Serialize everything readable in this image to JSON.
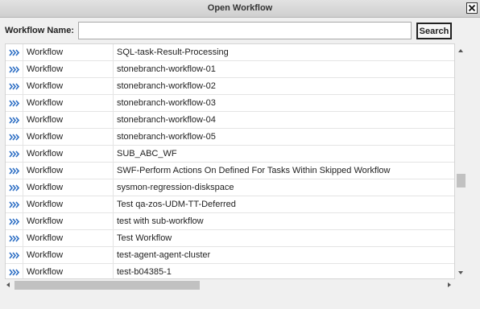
{
  "dialog": {
    "title": "Open Workflow",
    "close_icon": "close-x-icon"
  },
  "search": {
    "label": "Workflow Name:",
    "value": "",
    "placeholder": "",
    "button_label": "Search"
  },
  "table": {
    "row_icon": "triple-chevron-right-icon",
    "row_icon_color": "#2e6fc4",
    "rows": [
      {
        "type": "Workflow",
        "name": "SQL-task-Result-Processing"
      },
      {
        "type": "Workflow",
        "name": "stonebranch-workflow-01"
      },
      {
        "type": "Workflow",
        "name": "stonebranch-workflow-02"
      },
      {
        "type": "Workflow",
        "name": "stonebranch-workflow-03"
      },
      {
        "type": "Workflow",
        "name": "stonebranch-workflow-04"
      },
      {
        "type": "Workflow",
        "name": "stonebranch-workflow-05"
      },
      {
        "type": "Workflow",
        "name": "SUB_ABC_WF"
      },
      {
        "type": "Workflow",
        "name": "SWF-Perform Actions On Defined For Tasks Within Skipped Workflow"
      },
      {
        "type": "Workflow",
        "name": "sysmon-regression-diskspace"
      },
      {
        "type": "Workflow",
        "name": "Test qa-zos-UDM-TT-Deferred"
      },
      {
        "type": "Workflow",
        "name": "test with sub-workflow"
      },
      {
        "type": "Workflow",
        "name": "Test Workflow"
      },
      {
        "type": "Workflow",
        "name": "test-agent-agent-cluster"
      },
      {
        "type": "Workflow",
        "name": "test-b04385-1"
      }
    ]
  },
  "scroll": {
    "vertical_position_fraction": 0.6,
    "horizontal_visible_fraction": 0.43
  }
}
